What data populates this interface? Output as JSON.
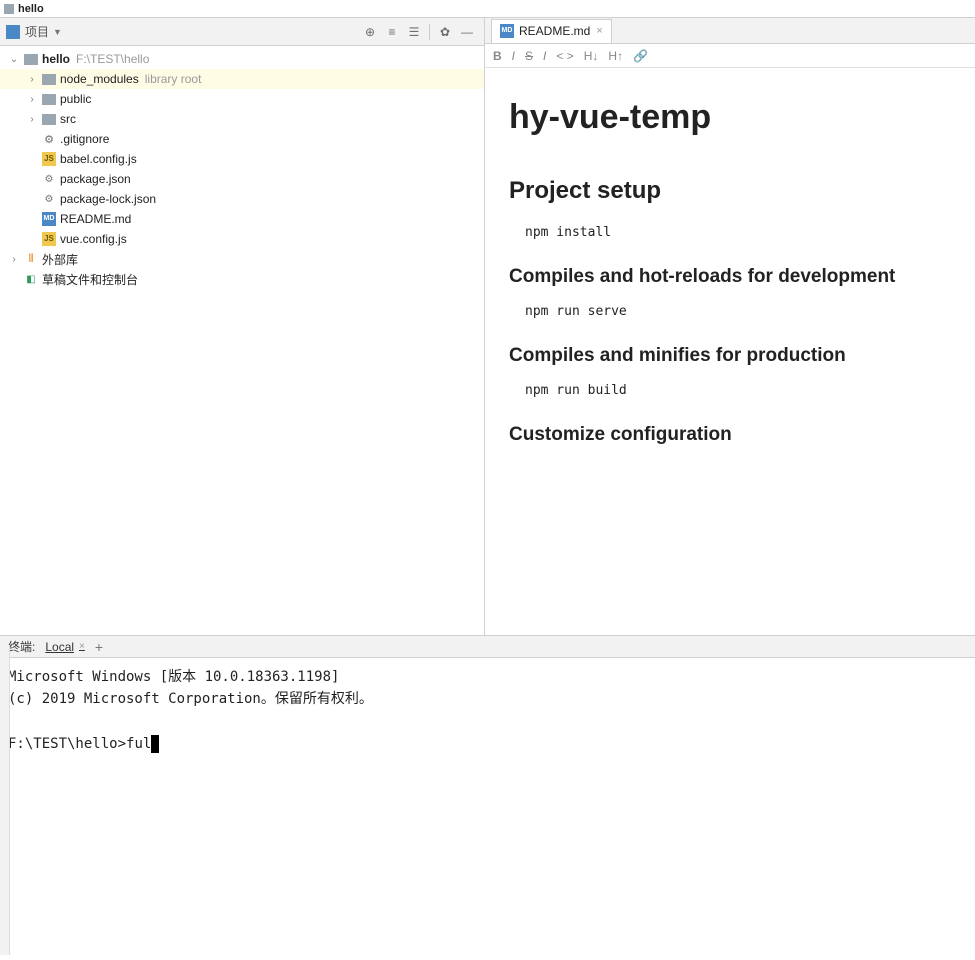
{
  "topTab": {
    "label": "hello"
  },
  "project": {
    "headerLabel": "项目",
    "root": {
      "name": "hello",
      "path": "F:\\TEST\\hello"
    },
    "items": [
      {
        "name": "node_modules",
        "extra": "library root",
        "indent": 1,
        "arrow": ">",
        "icon": "folder",
        "sel": true
      },
      {
        "name": "public",
        "indent": 1,
        "arrow": ">",
        "icon": "folder"
      },
      {
        "name": "src",
        "indent": 1,
        "arrow": ">",
        "icon": "folder"
      },
      {
        "name": ".gitignore",
        "indent": 1,
        "arrow": "",
        "icon": "gear"
      },
      {
        "name": "babel.config.js",
        "indent": 1,
        "arrow": "",
        "icon": "js"
      },
      {
        "name": "package.json",
        "indent": 1,
        "arrow": "",
        "icon": "json"
      },
      {
        "name": "package-lock.json",
        "indent": 1,
        "arrow": "",
        "icon": "json"
      },
      {
        "name": "README.md",
        "indent": 1,
        "arrow": "",
        "icon": "md"
      },
      {
        "name": "vue.config.js",
        "indent": 1,
        "arrow": "",
        "icon": "js"
      }
    ],
    "extLib": "外部库",
    "scratch": "草稿文件和控制台"
  },
  "editor": {
    "tabLabel": "README.md",
    "fmt": {
      "b": "B",
      "i": "I",
      "s": "S",
      "code": "< >",
      "hdown": "H↓",
      "hup": "H↑",
      "link": "🔗"
    }
  },
  "readme": {
    "h1": "hy-vue-temp",
    "h2a": "Project setup",
    "code_a": "npm install",
    "h3a": "Compiles and hot-reloads for development",
    "code_b": "npm run serve",
    "h3b": "Compiles and minifies for production",
    "code_c": "npm run build",
    "h3c": "Customize configuration"
  },
  "terminal": {
    "title": "终端:",
    "tab": "Local",
    "line1": "Microsoft Windows [版本 10.0.18363.1198]",
    "line2": "(c) 2019 Microsoft Corporation。保留所有权利。",
    "prompt": "F:\\TEST\\hello>",
    "typed": "ful"
  }
}
